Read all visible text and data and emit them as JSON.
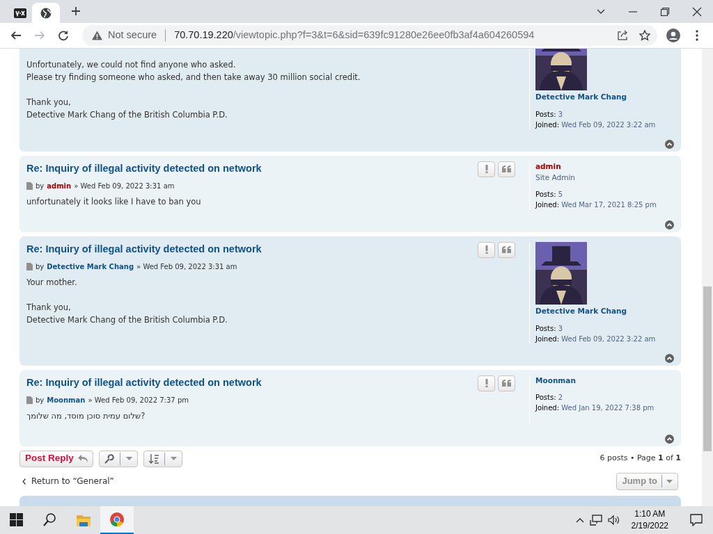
{
  "browser": {
    "tabs": [
      {
        "kind": "vox",
        "selected": false
      },
      {
        "kind": "globe",
        "selected": true
      }
    ],
    "security": "Not secure",
    "url_host": "70.70.19.220",
    "url_path": "/viewtopic.php?f=3&t=6&sid=639fc91280e26ee0fb3af4a604260594"
  },
  "posts": [
    {
      "kind": "continued",
      "paragraphs": [
        [
          "Unfortunately, we could not find anyone who asked.",
          "Please try finding someone who asked, and then take away 30 million social credit."
        ],
        [
          "Thank you,",
          "Detective Mark Chang of the British Columbia P.D."
        ]
      ],
      "profile": {
        "avatar": true,
        "name": "Detective Mark Chang",
        "color": "#105289",
        "posts_label": "Posts:",
        "posts": "3",
        "joined_label": "Joined:",
        "joined": "Wed Feb 09, 2022 3:22 am"
      }
    },
    {
      "kind": "full",
      "title": "Re: Inquiry of illegal activity detected on network",
      "by": "by",
      "author": {
        "name": "admin",
        "color": "#aa0000"
      },
      "date": "» Wed Feb 09, 2022 3:31 am",
      "paragraphs": [
        [
          "unfortunately it looks like I have to ban you"
        ]
      ],
      "profile": {
        "avatar": false,
        "name": "admin",
        "color": "#aa0000",
        "rank": "Site Admin",
        "posts_label": "Posts:",
        "posts": "5",
        "joined_label": "Joined:",
        "joined": "Wed Mar 17, 2021 8:25 pm"
      }
    },
    {
      "kind": "full",
      "title": "Re: Inquiry of illegal activity detected on network",
      "by": "by",
      "author": {
        "name": "Detective Mark Chang",
        "color": "#105289"
      },
      "date": "» Wed Feb 09, 2022 3:31 am",
      "paragraphs": [
        [
          "Your mother."
        ],
        [
          "Thank you,",
          "Detective Mark Chang of the British Columbia P.D."
        ]
      ],
      "profile": {
        "avatar": true,
        "name": "Detective Mark Chang",
        "color": "#105289",
        "posts_label": "Posts:",
        "posts": "3",
        "joined_label": "Joined:",
        "joined": "Wed Feb 09, 2022 3:22 am"
      }
    },
    {
      "kind": "full",
      "title": "Re: Inquiry of illegal activity detected on network",
      "by": "by",
      "author": {
        "name": "Moonman",
        "color": "#105289"
      },
      "date": "» Wed Feb 09, 2022 7:37 pm",
      "paragraphs": [
        [
          "שלום עמית סוכן מוסד, מה שלומך?"
        ]
      ],
      "profile": {
        "avatar": false,
        "name": "Moonman",
        "color": "#105289",
        "posts_label": "Posts:",
        "posts": "2",
        "joined_label": "Joined:",
        "joined": "Wed Jan 19, 2022 7:38 pm"
      }
    }
  ],
  "actions": {
    "post_reply": "Post Reply",
    "pagination": "6 posts • Page **1** of **1**",
    "return_link": "Return to “General”",
    "jump_to": "Jump to"
  },
  "taskbar": {
    "time": "1:10 AM",
    "date": "2/19/2022"
  }
}
